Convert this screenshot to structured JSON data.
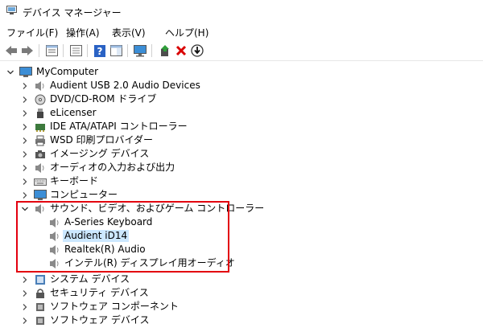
{
  "window": {
    "title": "デバイス マネージャー"
  },
  "menu": {
    "file": "ファイル(F)",
    "action": "操作(A)",
    "view": "表示(V)",
    "help": "ヘルプ(H)"
  },
  "toolbar": {
    "icons": [
      "back-arrow-icon",
      "forward-arrow-icon",
      "properties-icon",
      "show-hidden-icon",
      "help-icon",
      "action-pane-icon",
      "monitor-icon",
      "update-driver-icon",
      "uninstall-icon",
      "download-icon"
    ]
  },
  "tree": {
    "root": "MyComputer",
    "categories": [
      "Audient USB 2.0 Audio Devices",
      "DVD/CD-ROM ドライブ",
      "eLicenser",
      "IDE ATA/ATAPI コントローラー",
      "WSD 印刷プロバイダー",
      "イメージング デバイス",
      "オーディオの入力および出力",
      "キーボード",
      "コンピューター"
    ],
    "expanded_category": "サウンド、ビデオ、およびゲーム コントローラー",
    "children": [
      "A-Series Keyboard",
      "Audient iD14",
      "Realtek(R) Audio",
      "インテル(R) ディスプレイ用オーディオ"
    ],
    "selected_child": "Audient iD14",
    "after_categories": [
      "システム デバイス",
      "セキュリティ デバイス",
      "ソフトウェア コンポーネント",
      "ソフトウェア デバイス"
    ]
  },
  "colors": {
    "highlight_box": "#e3000f",
    "selection": "#cce8ff"
  }
}
